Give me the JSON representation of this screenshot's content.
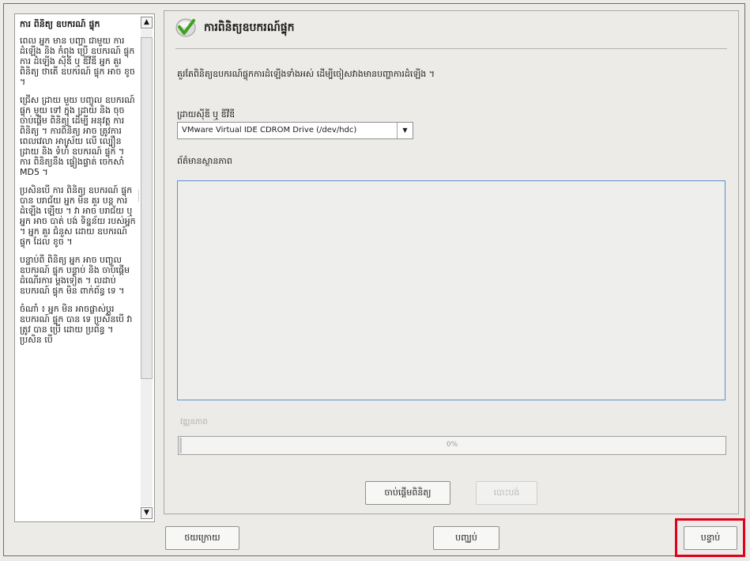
{
  "help": {
    "title": "ការ ពិនិត្យ ឧបករណ៍ ផ្ទុក",
    "paragraphs": [
      "ពេល អ្នក មាន បញ្ហា ជាមួយ ការ ដំឡើង និង កំពុង ប្រើ ឧបករណ៍ ផ្ទុក ការ ដំឡើង ស៊ីឌី ឬ ឌីវីឌី អ្នក គួរ ពិនិត្យ ថាតើ ឧបករណ៍ ផ្ទុក អាច ខូច ។",
      "ជ្រើស ដ្រាយ មួយ បញ្ចូល ឧបករណ៍ ផ្ទុក មួយ ទៅ ក្នុង ដ្រាយ និង ចុច ចាប់ផ្ដើម ពិនិត្យ ដើម្បី អនុវត្ត ការ ពិនិត្យ ។ ការពិនិត្យ អាច ត្រូវការ ពេលវេលា អាស្រ័យ លើ ល្បឿន ដ្រាយ និង ទំហំ ឧបករណ៍ ផ្ទុក ។ ការ ពិនិត្យនឹង ផ្ទៀងផ្ទាត់ ចេកសាំ MD5 ។",
      "ប្រសិនបើ ការ ពិនិត្យ ឧបករណ៍ ផ្ទុក បាន បរាជ័យ អ្នក មិន គួរ បន្ត ការ ដំឡើង ឡើយ ។ វា អាច បរាជ័យ ឬ អ្នក អាច បាត់ បង់ ទិន្នន័យ របស់អ្នក ។ អ្នក គួរ ជំនួស ដោយ ឧបករណ៍ ផ្ទុក ដែល ខូច ។",
      "បន្ទាប់ពី ពិនិត្យ អ្នក អាច បញ្ចូល ឧបករណ៍ ផ្ទុក បន្ទាប់ និង ចាប់ផ្ដើម ដំណើរការ ម្ដងទៀត ។ លដាប់ ឧបករណ៍ ផ្ទុក មិន ពាក់ព័ន្ធ ទេ ។",
      "ចំណាំ ៖ អ្នក មិន អាចផ្លាស់ប្ដូរ ឧបករណ៍ ផ្ទុក បាន ទេ ប្រសិនបើ វា ត្រូវ បាន ប្រើ ដោយ ប្រព័ន្ធ ។ ប្រសិន បើ"
    ]
  },
  "page": {
    "title": "ការពិនិត្យឧបករណ៍ផ្ទុក",
    "instruction": "គួរតែពិនិត្យឧបករណ៍ផ្ទុកការដំឡើងទាំងអស់ ដើម្បីចៀសវាងមានបញ្ហាការដំឡើង ។",
    "source_label": "ដ្រាយស៊ីឌី ឬ ឌីវីឌី",
    "drive_selected": "VMware Virtual IDE CDROM Drive (/dev/hdc)",
    "status_label": "ព័ត៌មានស្ថានភាព",
    "status_text": "",
    "progress_label": "វឌ្ឍនភាព",
    "progress_percent": 0,
    "progress_text": "0%",
    "start_button": "ចាប់ផ្ដើមពិនិត្យ",
    "eject_button": "បោះបង់"
  },
  "nav": {
    "back": "ថយក្រោយ",
    "abort": "បញ្ឈប់",
    "next": "បន្ទាប់"
  },
  "colors": {
    "highlight": "#e0001b",
    "status_border": "#5d8fd0",
    "logo_green": "#3fa21f"
  }
}
